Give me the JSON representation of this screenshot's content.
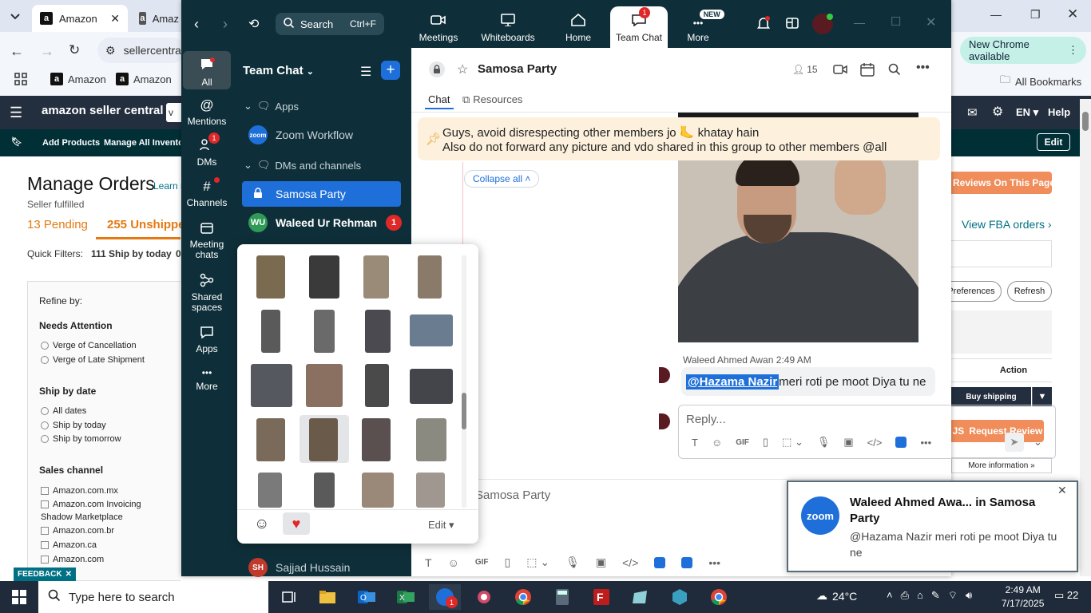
{
  "browser": {
    "tabs": [
      {
        "label": "Amazon"
      },
      {
        "label": "Amaz"
      }
    ],
    "address": "sellercentra",
    "bookmarks": [
      {
        "label": "Amazon"
      },
      {
        "label": "Amazon"
      }
    ],
    "all_bookmarks": "All Bookmarks",
    "update_label": "New Chrome available"
  },
  "seller_central": {
    "logo": "amazon seller central",
    "search_fragment": "v",
    "lang": "EN",
    "help": "Help",
    "sub_links": [
      "Add Products",
      "Manage All Inventory"
    ],
    "edit": "Edit",
    "title": "Manage Orders",
    "learn_more": "Learn m",
    "subtitle": "Seller fulfilled",
    "pending": "13 Pending",
    "unshipped": "255 Unshipped",
    "quick_filters": "Quick Filters:",
    "quick_filter_1": "111 Ship by today",
    "quick_filter_2": "0",
    "refine_by": "Refine by:",
    "needs_attention": "Needs Attention",
    "needs_attention_items": [
      "Verge of Cancellation",
      "Verge of Late Shipment"
    ],
    "ship_by_date": "Ship by date",
    "ship_by_items": [
      "All dates",
      "Ship by today",
      "Ship by tomorrow"
    ],
    "sales_channel": "Sales channel",
    "channel_items": [
      "Amazon.com.mx",
      "Amazon.com Invoicing",
      "Shadow Marketplace",
      "Amazon.com.br",
      "Amazon.ca",
      "Amazon.com"
    ],
    "feedback": "FEEDBACK",
    "reviews_btn": "Reviews On This Page",
    "fba_link": "View FBA orders",
    "preferences": "Preferences",
    "refresh": "Refresh",
    "action_col": "Action",
    "buy_shipping": "Buy shipping",
    "request_review": "Request Review",
    "more_info": "More information",
    "more_info_2": "More information"
  },
  "zoom": {
    "search": "Search",
    "search_shortcut": "Ctrl+F",
    "top_tabs": [
      {
        "label": "Meetings"
      },
      {
        "label": "Whiteboards"
      },
      {
        "label": "Home"
      },
      {
        "label": "Team Chat",
        "badge": "1"
      },
      {
        "label": "More",
        "badge": "NEW"
      }
    ],
    "rail": [
      {
        "label": "All"
      },
      {
        "label": "Mentions"
      },
      {
        "label": "DMs",
        "badge": "1"
      },
      {
        "label": "Channels"
      },
      {
        "label": "Meeting chats"
      },
      {
        "label": "Shared spaces"
      },
      {
        "label": "Apps"
      },
      {
        "label": "More"
      }
    ],
    "list_title": "Team Chat",
    "sections": {
      "apps": "Apps",
      "dms": "DMs and channels"
    },
    "list": {
      "zoom_workflow": "Zoom Workflow",
      "samosa": "Samosa Party",
      "waleed": "Waleed Ur Rehman",
      "waleed_initials": "WU",
      "waleed_badge": "1",
      "sajjad": "Sajjad Hussain",
      "sajjad_initials": "SH"
    },
    "chat": {
      "title": "Samosa Party",
      "members": "15",
      "tab_chat": "Chat",
      "tab_resources": "Resources",
      "pinned_line1": "Guys, avoid disrespecting other members jo 🦶 khatay hain",
      "pinned_line2": "Also do not forward any picture and vdo shared in this group to other members @all",
      "collapse": "Collapse all",
      "sender": "Waleed Ahmed Awan",
      "time": "2:49 AM",
      "mention": "@Hazama Nazir",
      "message_rest": " meri roti pe moot Diya tu ne",
      "reply_placeholder": "Reply...",
      "composer_placeholder": "Samosa Party"
    },
    "sticker_panel": {
      "edit": "Edit"
    }
  },
  "toast": {
    "logo": "zoom",
    "title": "Waleed Ahmed Awa... in Samosa Party",
    "body": "@Hazama Nazir meri roti pe moot Diya tu ne"
  },
  "taskbar": {
    "search": "Type here to search",
    "weather": "24°C",
    "time": "2:49 AM",
    "date": "7/17/2025",
    "notifications": "22",
    "zoom_badge": "1"
  }
}
